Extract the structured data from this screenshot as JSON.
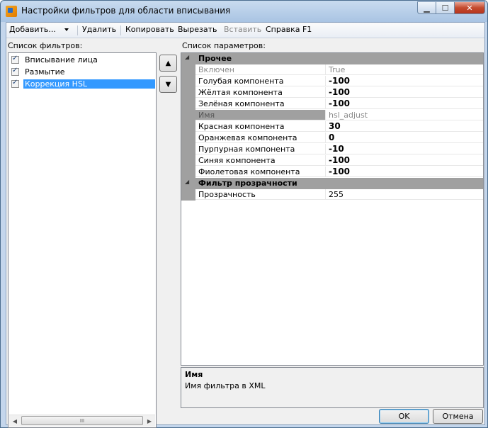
{
  "window": {
    "title": "Настройки фильтров для области вписывания"
  },
  "menubar": {
    "add": "Добавить...",
    "delete": "Удалить",
    "copy": "Копировать",
    "cut": "Вырезать",
    "paste": "Вставить",
    "help": "Справка  F1"
  },
  "filters": {
    "label": "Список фильтров:",
    "items": [
      {
        "label": "Вписывание лица",
        "checked": true
      },
      {
        "label": "Размытие",
        "checked": true
      },
      {
        "label": "Коррекция HSL",
        "checked": true,
        "selected": true
      }
    ],
    "scroll_grip": "III"
  },
  "params": {
    "label": "Список параметров:",
    "categories": [
      {
        "name": "Прочее",
        "rows": [
          {
            "name": "Включен",
            "value": "True"
          },
          {
            "name": "Голубая компонента",
            "value": "-100"
          },
          {
            "name": "Жёлтая компонента",
            "value": "-100"
          },
          {
            "name": "Зелёная компонента",
            "value": "-100"
          },
          {
            "name": "Имя",
            "value": "hsl_adjust"
          },
          {
            "name": "Красная компонента",
            "value": "30"
          },
          {
            "name": "Оранжевая компонента",
            "value": "0"
          },
          {
            "name": "Пурпурная компонента",
            "value": "-10"
          },
          {
            "name": "Синяя компонента",
            "value": "-100"
          },
          {
            "name": "Фиолетовая компонента",
            "value": "-100"
          }
        ]
      },
      {
        "name": "Фильтр прозрачности",
        "rows": [
          {
            "name": "Прозрачность",
            "value": "255"
          }
        ]
      }
    ]
  },
  "help": {
    "title": "Имя",
    "description": "Имя фильтра в XML"
  },
  "buttons": {
    "ok": "OK",
    "cancel": "Отмена"
  }
}
